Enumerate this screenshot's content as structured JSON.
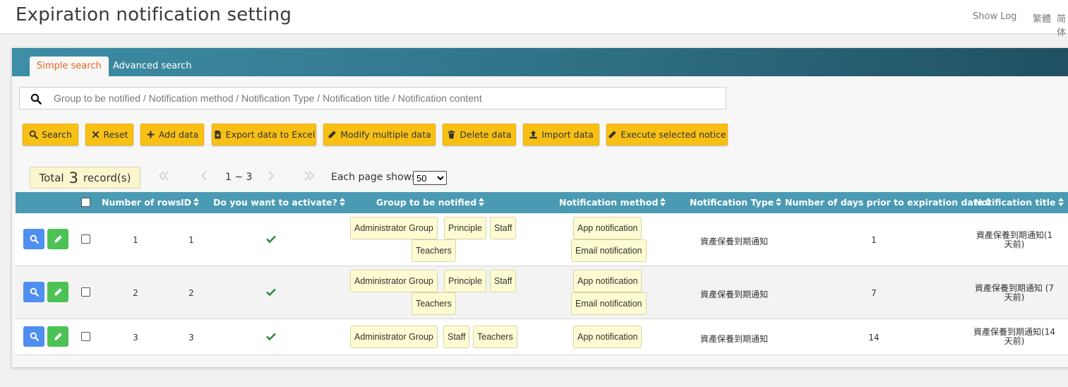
{
  "page": {
    "title": "Expiration notification setting",
    "show_log": "Show Log",
    "lang_traditional": "繁體",
    "lang_simplified": "简体"
  },
  "tabs": [
    {
      "label": "Simple search",
      "active": true
    },
    {
      "label": "Advanced search",
      "active": false
    }
  ],
  "search": {
    "placeholder": "Group to be notified / Notification method / Notification Type / Notification title / Notification content",
    "value": ""
  },
  "toolbar": {
    "search": "Search",
    "reset": "Reset",
    "add": "Add data",
    "export": "Export data to Excel",
    "modify": "Modify multiple data",
    "delete": "Delete data",
    "import": "Import data",
    "execute": "Execute selected notice"
  },
  "pagination": {
    "total_prefix": "Total",
    "total_count": "3",
    "total_suffix": "record(s)",
    "range": "1 ~ 3",
    "each_page_label": "Each page shows:",
    "page_size": "50"
  },
  "columns": {
    "row_number": "Number of rows",
    "id": "ID",
    "activate": "Do you want to activate?",
    "group": "Group to be notified",
    "method": "Notification method",
    "type": "Notification Type",
    "days": "Number of days prior to expiration date",
    "title": "Notification title"
  },
  "rows": [
    {
      "row_number": "1",
      "id": "1",
      "active": true,
      "groups": [
        "Administrator Group",
        "Principle",
        "Staff",
        "Teachers"
      ],
      "methods": [
        "App notification",
        "Email notification"
      ],
      "type": "資產保養到期通知",
      "days": "1",
      "title": "資產保養到期通知(1天前)"
    },
    {
      "row_number": "2",
      "id": "2",
      "active": true,
      "groups": [
        "Administrator Group",
        "Principle",
        "Staff",
        "Teachers"
      ],
      "methods": [
        "App notification",
        "Email notification"
      ],
      "type": "資產保養到期通知",
      "days": "7",
      "title": "資產保養到期通知 (7天前)"
    },
    {
      "row_number": "3",
      "id": "3",
      "active": true,
      "groups": [
        "Administrator Group",
        "Staff",
        "Teachers"
      ],
      "methods": [
        "App notification"
      ],
      "type": "資產保養到期通知",
      "days": "14",
      "title": "資產保養到期通知(14天前)"
    }
  ],
  "colors": {
    "tab_bar": "#2f6f84",
    "table_header": "#4a9ab3",
    "button": "#f8c015",
    "tag": "#fdfbd1",
    "view_button": "#4f8ff0",
    "edit_button": "#4cc255",
    "active_tab_text": "#e8651f",
    "check": "#2e8b3e"
  },
  "icons": {
    "search": "magnifier-icon",
    "reset": "x-icon",
    "add": "plus-icon",
    "export": "file-download-icon",
    "modify": "pencil-icon",
    "delete": "trash-icon",
    "import": "upload-icon",
    "execute": "pencil-icon",
    "sort": "sort-icon",
    "active": "check-icon",
    "view": "magnifier-icon",
    "edit": "pencil-icon"
  }
}
